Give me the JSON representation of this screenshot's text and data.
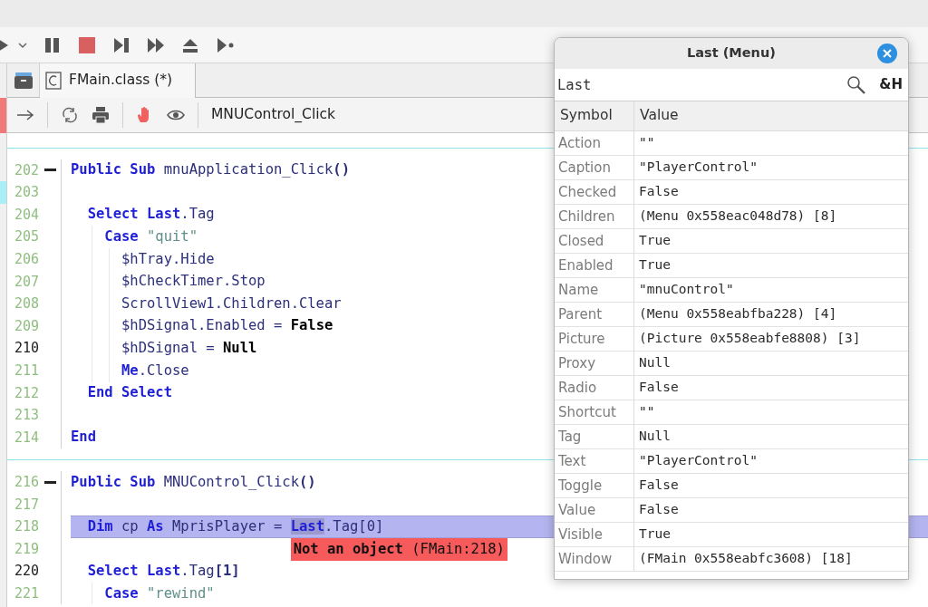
{
  "tab": {
    "label": "FMain.class (*)",
    "selected": true
  },
  "procedure": "MNUControl_Click",
  "rows": [
    {
      "kind": "separator"
    },
    {
      "kind": "code",
      "number": "202",
      "fold": true,
      "active": false,
      "marker": false,
      "highlighted": false,
      "tokens": [
        {
          "kind": "kw",
          "t": "Public Sub "
        },
        {
          "kind": "id",
          "t": "mnuApplication_Click"
        },
        {
          "kind": "punct",
          "t": "()"
        }
      ]
    },
    {
      "kind": "code",
      "number": "203",
      "fold": false,
      "active": false,
      "marker": true,
      "highlighted": false
    },
    {
      "kind": "code",
      "number": "204",
      "fold": false,
      "active": false,
      "marker": false,
      "highlighted": false,
      "tokens": [
        {
          "kind": "kw",
          "t": "  Select Last"
        },
        {
          "kind": "id",
          "t": ".Tag"
        }
      ]
    },
    {
      "kind": "code",
      "number": "205",
      "fold": false,
      "active": false,
      "marker": false,
      "highlighted": false,
      "tokens": [
        {
          "kind": "kw",
          "t": "    Case "
        },
        {
          "kind": "str",
          "t": "\"quit\""
        }
      ]
    },
    {
      "kind": "code",
      "number": "206",
      "fold": false,
      "active": false,
      "marker": false,
      "highlighted": false,
      "tokens": [
        {
          "kind": "id",
          "t": "      $hTray.Hide"
        }
      ]
    },
    {
      "kind": "code",
      "number": "207",
      "fold": false,
      "active": false,
      "marker": false,
      "highlighted": false,
      "tokens": [
        {
          "kind": "id",
          "t": "      $hCheckTimer.Stop"
        }
      ]
    },
    {
      "kind": "code",
      "number": "208",
      "fold": false,
      "active": false,
      "marker": false,
      "highlighted": false,
      "tokens": [
        {
          "kind": "id",
          "t": "      ScrollView1.Children.Clear"
        }
      ]
    },
    {
      "kind": "code",
      "number": "209",
      "fold": false,
      "active": false,
      "marker": false,
      "highlighted": false,
      "tokens": [
        {
          "kind": "id",
          "t": "      $hDSignal.Enabled = "
        },
        {
          "kind": "lit",
          "t": "False"
        }
      ]
    },
    {
      "kind": "code",
      "number": "210",
      "fold": false,
      "active": true,
      "marker": false,
      "highlighted": false,
      "tokens": [
        {
          "kind": "id",
          "t": "      $hDSignal = "
        },
        {
          "kind": "lit",
          "t": "Null"
        }
      ]
    },
    {
      "kind": "code",
      "number": "211",
      "fold": false,
      "active": false,
      "marker": false,
      "highlighted": false,
      "tokens": [
        {
          "kind": "kw",
          "t": "      Me"
        },
        {
          "kind": "id",
          "t": ".Close"
        }
      ]
    },
    {
      "kind": "code",
      "number": "212",
      "fold": false,
      "active": false,
      "marker": false,
      "highlighted": false,
      "tokens": [
        {
          "kind": "kw",
          "t": "  End Select"
        }
      ]
    },
    {
      "kind": "code",
      "number": "213",
      "fold": false,
      "active": false,
      "marker": false,
      "highlighted": false
    },
    {
      "kind": "code",
      "number": "214",
      "fold": false,
      "active": false,
      "marker": false,
      "highlighted": false,
      "tokens": [
        {
          "kind": "kw",
          "t": "End"
        }
      ]
    },
    {
      "kind": "separator"
    },
    {
      "kind": "code",
      "number": "216",
      "fold": true,
      "active": false,
      "marker": false,
      "highlighted": false,
      "tokens": [
        {
          "kind": "kw",
          "t": "Public Sub "
        },
        {
          "kind": "id",
          "t": "MNUControl_Click"
        },
        {
          "kind": "punct",
          "t": "()"
        }
      ]
    },
    {
      "kind": "code",
      "number": "217",
      "fold": false,
      "active": false,
      "marker": false,
      "highlighted": false
    },
    {
      "kind": "code",
      "number": "218",
      "fold": false,
      "active": false,
      "marker": false,
      "highlighted": true,
      "tokens": [
        {
          "kind": "kw",
          "t": "  Dim "
        },
        {
          "kind": "id",
          "t": "cp "
        },
        {
          "kind": "kw",
          "t": "As "
        },
        {
          "kind": "id",
          "t": "MprisPlayer = "
        },
        {
          "kind": "sel",
          "t": "Last"
        },
        {
          "kind": "id",
          "t": ".Tag[0]"
        }
      ],
      "error": "**Not an object** (FMain:218)"
    },
    {
      "kind": "code",
      "number": "219",
      "fold": false,
      "active": false,
      "marker": false,
      "highlighted": false
    },
    {
      "kind": "code",
      "number": "220",
      "fold": false,
      "active": true,
      "marker": false,
      "highlighted": false,
      "tokens": [
        {
          "kind": "kw",
          "t": "  Select Last"
        },
        {
          "kind": "id",
          "t": ".Tag"
        },
        {
          "kind": "punct",
          "t": "[1]"
        }
      ]
    },
    {
      "kind": "code",
      "number": "221",
      "fold": false,
      "active": false,
      "marker": false,
      "highlighted": false,
      "tokens": [
        {
          "kind": "kw",
          "t": "    Case "
        },
        {
          "kind": "str",
          "t": "\"rewind\""
        }
      ]
    }
  ],
  "popup": {
    "title": "Last (Menu)",
    "search": {
      "value": "Last"
    },
    "hex_button": "&H",
    "columns": [
      "Symbol",
      "Value"
    ],
    "rows": [
      {
        "symbol": "Action",
        "value": "\"\""
      },
      {
        "symbol": "Caption",
        "value": "\"PlayerControl\""
      },
      {
        "symbol": "Checked",
        "value": "False"
      },
      {
        "symbol": "Children",
        "value": "(Menu 0x558eac048d78) [8]"
      },
      {
        "symbol": "Closed",
        "value": "True"
      },
      {
        "symbol": "Enabled",
        "value": "True"
      },
      {
        "symbol": "Name",
        "value": "\"mnuControl\""
      },
      {
        "symbol": "Parent",
        "value": "(Menu 0x558eabfba228) [4]"
      },
      {
        "symbol": "Picture",
        "value": "(Picture 0x558eabfe8808) [3]"
      },
      {
        "symbol": "Proxy",
        "value": "Null"
      },
      {
        "symbol": "Radio",
        "value": "False"
      },
      {
        "symbol": "Shortcut",
        "value": "\"\""
      },
      {
        "symbol": "Tag",
        "value": "Null"
      },
      {
        "symbol": "Text",
        "value": "\"PlayerControl\""
      },
      {
        "symbol": "Toggle",
        "value": "False"
      },
      {
        "symbol": "Value",
        "value": "False"
      },
      {
        "symbol": "Visible",
        "value": "True"
      },
      {
        "symbol": "Window",
        "value": "(FMain 0x558eabfc3608) [18]"
      }
    ]
  }
}
